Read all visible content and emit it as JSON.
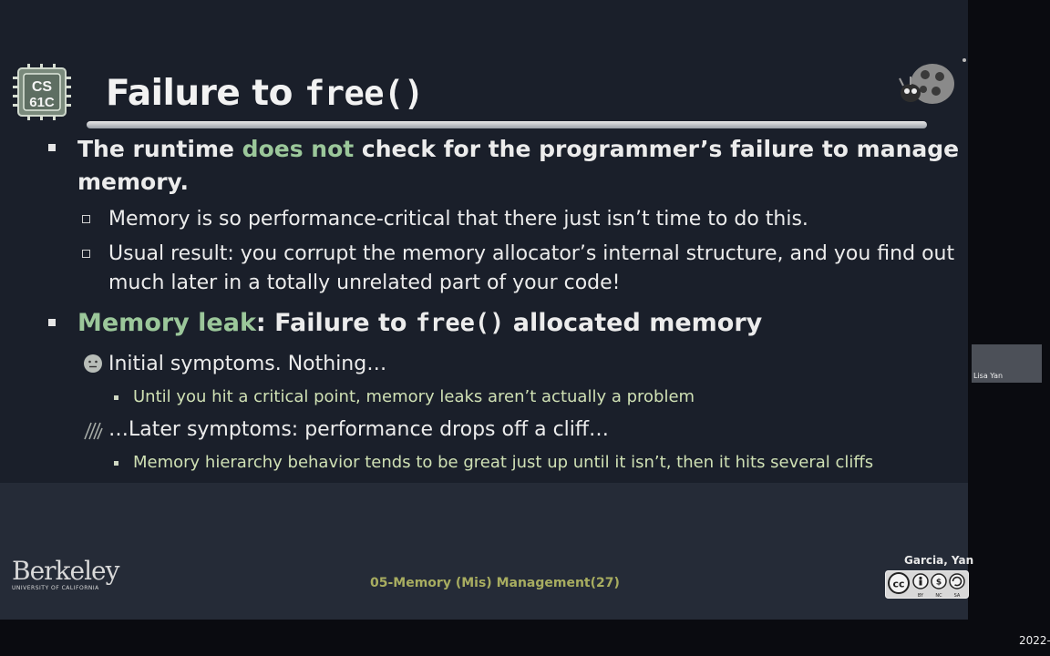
{
  "slide": {
    "logo_text_top": "CS",
    "logo_text_bottom": "61C",
    "title_text": "Failure to ",
    "title_code": "free()",
    "bullets": {
      "b1_prefix": "The runtime ",
      "b1_highlight": "does not",
      "b1_rest": " check for the programmer’s failure to manage",
      "b1_cont": "memory.",
      "b1_sub1": "Memory is so performance-critical that there just isn’t time to do this.",
      "b1_sub2_line1": "Usual result: you corrupt the memory allocator’s internal structure, and you find out",
      "b1_sub2_line2": "much later in a totally unrelated part of your code!",
      "b2_highlight": "Memory leak",
      "b2_rest": ": Failure to ",
      "b2_code": "free()",
      "b2_end": " allocated memory",
      "b2_sub1": "Initial symptoms. Nothing…",
      "b2_sub1_detail": "Until you hit a critical point, memory leaks aren’t actually a problem",
      "b2_sub2": "…Later symptoms: performance drops off a cliff…",
      "b2_sub2_detail": "Memory hierarchy behavior tends to be great just up until it isn’t, then it hits several cliffs"
    },
    "footer": {
      "berkeley": "Berkeley",
      "berkeley_sub": "UNIVERSITY OF CALIFORNIA",
      "center": "05-Memory (Mis) Management(27)",
      "authors": "Garcia, Yan",
      "cc_labels": [
        "BY",
        "NC",
        "SA"
      ]
    }
  },
  "video": {
    "participant_name": "Lisa Yan",
    "date_text": "2022-"
  },
  "colors": {
    "highlight_green": "#9bc79a",
    "slide_background": "#1a1f2a",
    "footer_text": "#a8ad60"
  }
}
